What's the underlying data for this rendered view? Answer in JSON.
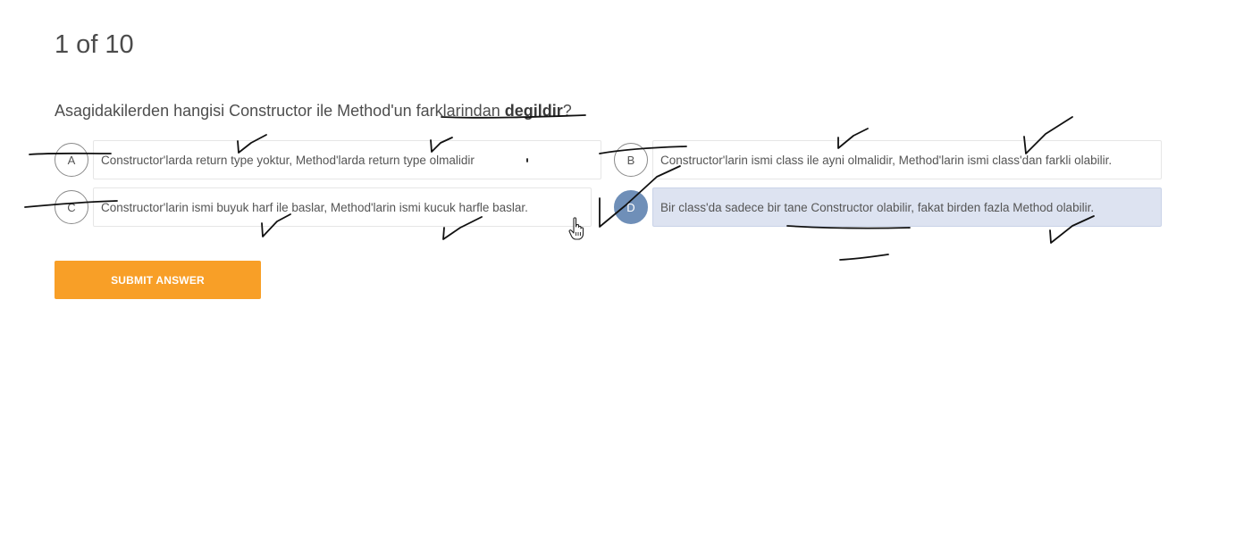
{
  "progress": {
    "text": "1 of 10"
  },
  "question": {
    "prefix": "Asagidakilerden hangisi Constructor ile Method'un farklarindan ",
    "bold": "degildir",
    "suffix": "?"
  },
  "options": [
    {
      "letter": "A",
      "text": "Constructor'larda return type yoktur, Method'larda return type olmalidir",
      "selected": false
    },
    {
      "letter": "B",
      "text": "Constructor'larin ismi class ile ayni olmalidir, Method'larin ismi class'dan farkli olabilir.",
      "selected": false
    },
    {
      "letter": "C",
      "text": "Constructor'larin ismi buyuk harf ile baslar, Method'larin ismi kucuk harfle baslar.",
      "selected": false
    },
    {
      "letter": "D",
      "text": "Bir class'da sadece bir tane Constructor olabilir, fakat birden fazla Method olabilir.",
      "selected": true
    }
  ],
  "submit": {
    "label": "SUBMIT ANSWER"
  },
  "colors": {
    "accent": "#f89f27",
    "selected_circle": "#6f8fb8",
    "selected_box": "#dde3f1",
    "ink": "#111111"
  }
}
